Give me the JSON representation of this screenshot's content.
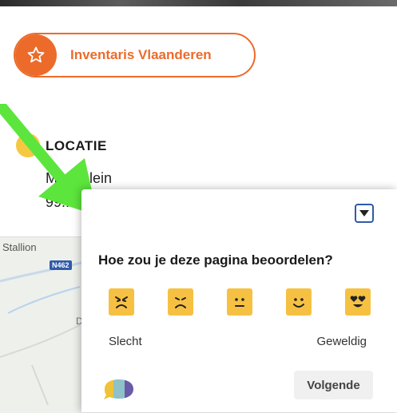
{
  "tag": {
    "label": "Inventaris Vlaanderen",
    "icon": "star-icon",
    "color": "#ec6b2b"
  },
  "locatie": {
    "title": "LOCATIE",
    "address_line_1": "Marktplein",
    "address_line_2": "99..."
  },
  "map": {
    "place_label": "Stallion",
    "road_badge": "N462",
    "partial_letter": "D"
  },
  "feedback": {
    "question": "Hoe zou je deze pagina beoordelen?",
    "collapse_icon": "chevron-down-icon",
    "ratings": [
      {
        "name": "very-angry-face-icon",
        "level": 1
      },
      {
        "name": "sad-face-icon",
        "level": 2
      },
      {
        "name": "neutral-face-icon",
        "level": 3
      },
      {
        "name": "smile-face-icon",
        "level": 4
      },
      {
        "name": "heart-eyes-face-icon",
        "level": 5
      }
    ],
    "scale_low": "Slecht",
    "scale_high": "Geweldig",
    "next_label": "Volgende",
    "face_color": "#f6c142",
    "accent_blue": "#2f5aa8"
  },
  "annotation": {
    "arrow_color": "#5ce53c"
  }
}
